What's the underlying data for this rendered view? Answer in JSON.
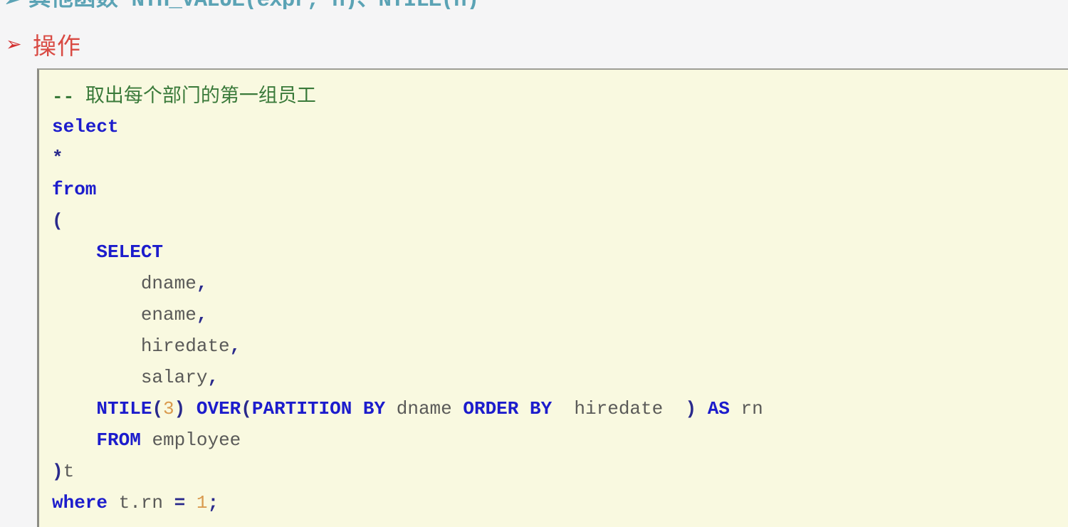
{
  "slide": {
    "top_heading": {
      "bullet": "➢",
      "text_cn": "其他函数",
      "text_mono": "NTH_VALUE(expr, n)、NTILE(n)",
      "color": "#5ba3b5"
    },
    "section": {
      "bullet": "➢",
      "title": "操作",
      "color": "#d94a43"
    }
  },
  "code": {
    "language": "sql",
    "background": "#f9f9e0",
    "colors": {
      "keyword": "#1c1ccc",
      "comment": "#3a7a3a",
      "identifier": "#5a5a58",
      "number": "#d99a4e",
      "punctuation": "#2a2a8c"
    },
    "lines": [
      {
        "id": "line-1",
        "tokens": [
          {
            "t": "--",
            "k": "comment-dash"
          },
          {
            "t": " ",
            "k": "plain"
          },
          {
            "t": "取出每个部门的第一组员工",
            "k": "comment"
          }
        ]
      },
      {
        "id": "line-2",
        "tokens": [
          {
            "t": "select",
            "k": "kw"
          }
        ]
      },
      {
        "id": "line-3",
        "tokens": [
          {
            "t": "*",
            "k": "punct"
          }
        ]
      },
      {
        "id": "line-4",
        "tokens": [
          {
            "t": "from",
            "k": "kw"
          }
        ]
      },
      {
        "id": "line-5",
        "tokens": [
          {
            "t": "(",
            "k": "punct"
          }
        ]
      },
      {
        "id": "line-6",
        "tokens": [
          {
            "t": "    ",
            "k": "plain"
          },
          {
            "t": "SELECT",
            "k": "kw"
          }
        ]
      },
      {
        "id": "line-7",
        "tokens": [
          {
            "t": "        ",
            "k": "plain"
          },
          {
            "t": "dname",
            "k": "ident"
          },
          {
            "t": ",",
            "k": "punct"
          }
        ]
      },
      {
        "id": "line-8",
        "tokens": [
          {
            "t": "        ",
            "k": "plain"
          },
          {
            "t": "ename",
            "k": "ident"
          },
          {
            "t": ",",
            "k": "punct"
          }
        ]
      },
      {
        "id": "line-9",
        "tokens": [
          {
            "t": "        ",
            "k": "plain"
          },
          {
            "t": "hiredate",
            "k": "ident"
          },
          {
            "t": ",",
            "k": "punct"
          }
        ]
      },
      {
        "id": "line-10",
        "tokens": [
          {
            "t": "        ",
            "k": "plain"
          },
          {
            "t": "salary",
            "k": "ident"
          },
          {
            "t": ",",
            "k": "punct"
          }
        ]
      },
      {
        "id": "line-11",
        "tokens": [
          {
            "t": "    ",
            "k": "plain"
          },
          {
            "t": "NTILE",
            "k": "kw"
          },
          {
            "t": "(",
            "k": "punct"
          },
          {
            "t": "3",
            "k": "num"
          },
          {
            "t": ")",
            "k": "punct"
          },
          {
            "t": " ",
            "k": "plain"
          },
          {
            "t": "OVER",
            "k": "kw"
          },
          {
            "t": "(",
            "k": "punct"
          },
          {
            "t": "PARTITION BY",
            "k": "kw"
          },
          {
            "t": " ",
            "k": "plain"
          },
          {
            "t": "dname",
            "k": "ident"
          },
          {
            "t": " ",
            "k": "plain"
          },
          {
            "t": "ORDER BY",
            "k": "kw"
          },
          {
            "t": "  ",
            "k": "plain"
          },
          {
            "t": "hiredate",
            "k": "ident"
          },
          {
            "t": "  ",
            "k": "plain"
          },
          {
            "t": ")",
            "k": "punct"
          },
          {
            "t": " ",
            "k": "plain"
          },
          {
            "t": "AS",
            "k": "kw"
          },
          {
            "t": " ",
            "k": "plain"
          },
          {
            "t": "rn",
            "k": "ident"
          }
        ]
      },
      {
        "id": "line-12",
        "tokens": [
          {
            "t": "    ",
            "k": "plain"
          },
          {
            "t": "FROM",
            "k": "kw"
          },
          {
            "t": " ",
            "k": "plain"
          },
          {
            "t": "employee",
            "k": "ident"
          }
        ]
      },
      {
        "id": "line-13",
        "tokens": [
          {
            "t": ")",
            "k": "punct"
          },
          {
            "t": "t",
            "k": "ident"
          }
        ]
      },
      {
        "id": "line-14",
        "tokens": [
          {
            "t": "where",
            "k": "kw"
          },
          {
            "t": " ",
            "k": "plain"
          },
          {
            "t": "t.rn",
            "k": "ident"
          },
          {
            "t": " ",
            "k": "plain"
          },
          {
            "t": "=",
            "k": "punct"
          },
          {
            "t": " ",
            "k": "plain"
          },
          {
            "t": "1",
            "k": "num"
          },
          {
            "t": ";",
            "k": "punct"
          }
        ]
      }
    ]
  }
}
